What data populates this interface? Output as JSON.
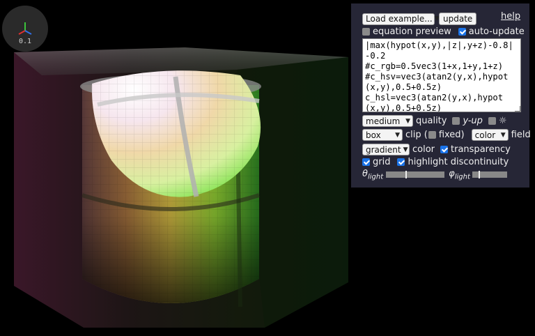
{
  "viewer": {
    "axis_scale": "0.1"
  },
  "panel": {
    "example_select": "Load example...",
    "update_label": "update",
    "help_label": "help",
    "equation_preview_label": "equation preview",
    "equation_preview_checked": false,
    "auto_update_label": "auto-update",
    "auto_update_checked": true,
    "equation": "|max(hypot(x,y),|z|,y+z)-0.8|-0.2\n#c_rgb=0.5vec3(1+x,1+y,1+z)\n#c_hsv=vec3(atan2(y,x),hypot(x,y),0.5+0.5z)\nc_hsl=vec3(atan2(y,x),hypot(x,y),0.5+0.5z)",
    "quality_select": "medium",
    "quality_label": "quality",
    "y_up_label": "y-up",
    "y_up_checked": false,
    "sun_icon_glyph": "☼",
    "light_checked": false,
    "clip_select": "box",
    "clip_label_open": "clip (",
    "fixed_label": "fixed)",
    "fixed_checked": false,
    "field_select": "color",
    "field_label": "field",
    "color_select": "gradient",
    "color_label": "color",
    "transparency_label": "transparency",
    "transparency_checked": true,
    "grid_label": "grid",
    "grid_checked": true,
    "highlight_label": "highlight discontinuity",
    "highlight_checked": true,
    "theta_symbol": "θ",
    "theta_sub": "light",
    "phi_symbol": "φ",
    "phi_sub": "light",
    "theta_value": 0.33,
    "phi_value": 0.18
  }
}
